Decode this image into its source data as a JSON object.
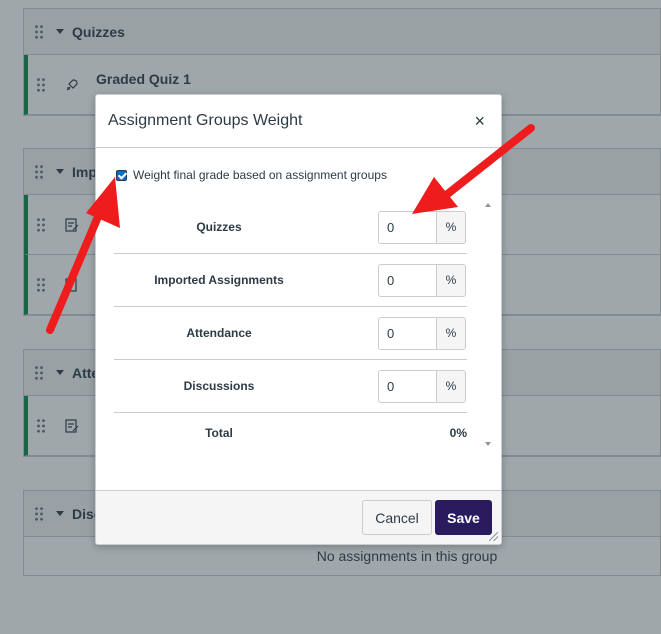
{
  "background": {
    "groups": [
      {
        "title": "Quizzes",
        "items": [
          {
            "title": "Graded Quiz 1",
            "icon": "rocket-icon"
          }
        ]
      },
      {
        "title": "Impo",
        "items": [
          {
            "title": "",
            "icon": "assignment-icon"
          },
          {
            "title": "",
            "icon": "assignment-icon"
          }
        ]
      },
      {
        "title": "Atte",
        "items": [
          {
            "title": "",
            "icon": "assignment-icon"
          }
        ]
      },
      {
        "title": "Disc",
        "empty_note": "No assignments in this group"
      }
    ]
  },
  "modal": {
    "title": "Assignment Groups Weight",
    "close_glyph": "×",
    "checkbox_label": "Weight final grade based on assignment groups",
    "checkbox_checked": true,
    "weights": [
      {
        "name": "Quizzes",
        "value": "0",
        "suffix": "%"
      },
      {
        "name": "Imported Assignments",
        "value": "0",
        "suffix": "%"
      },
      {
        "name": "Attendance",
        "value": "0",
        "suffix": "%"
      },
      {
        "name": "Discussions",
        "value": "0",
        "suffix": "%"
      }
    ],
    "total_label": "Total",
    "total_value": "0%",
    "cancel_label": "Cancel",
    "save_label": "Save"
  },
  "colors": {
    "accent_item_bar": "#0b874b",
    "save_button": "#2a1a5e",
    "annotation_arrow": "#ee1c1c",
    "checkbox": "#0770c4"
  }
}
